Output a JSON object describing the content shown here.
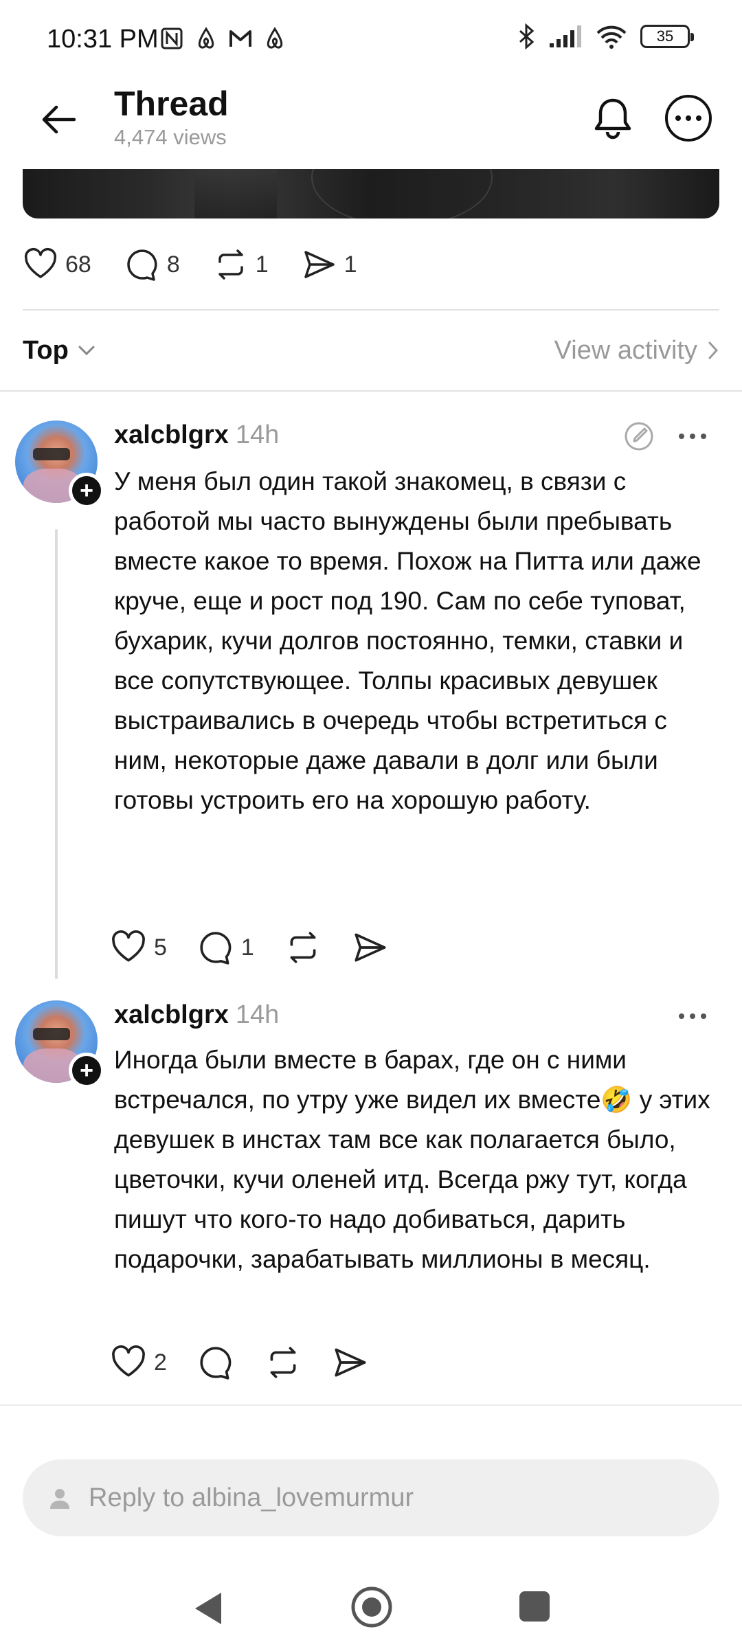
{
  "status_bar": {
    "time": "10:31 PM",
    "battery": "35",
    "icons_left": [
      "nfc-icon",
      "airbnb-icon",
      "gmail-icon",
      "airbnb-icon"
    ],
    "icons_right": [
      "bluetooth-icon",
      "signal-icon",
      "wifi-icon",
      "battery-icon"
    ]
  },
  "header": {
    "title": "Thread",
    "views": "4,474 views"
  },
  "post": {
    "likes": "68",
    "comments": "8",
    "reposts": "1",
    "shares": "1"
  },
  "sort": {
    "label": "Top",
    "view_activity": "View activity"
  },
  "replies": [
    {
      "username": "xalcblgrx",
      "time": "14h",
      "text": "У меня был один такой знакомец, в связи с работой мы часто вынуждены были пребывать вместе какое то время. Похож на Питта или даже круче, еще и рост под 190. Сам по себе туповат, бухарик, кучи долгов постоянно, темки, ставки и все сопутствующее. Толпы красивых девушек выстраивались в очередь чтобы встретиться с ним, некоторые даже давали в долг или были готовы устроить его на хорошую работу.",
      "likes": "5",
      "comments": "1"
    },
    {
      "username": "xalcblgrx",
      "time": "14h",
      "text": "Иногда были вместе в барах, где он с ними встречался, по утру уже видел их вместе🤣 у этих девушек в инстах там все как полагается было, цветочки, кучи оленей итд. Всегда ржу тут, когда пишут что кого-то надо добиваться, дарить подарочки, зарабатывать миллионы в месяц.",
      "likes": "2",
      "comments": ""
    }
  ],
  "reply_bar": {
    "placeholder": "Reply to albina_lovemurmur"
  },
  "colors": {
    "text": "#111111",
    "muted": "#9a9a9a",
    "divider": "#e2e2e2",
    "input_bg": "#efefef"
  }
}
